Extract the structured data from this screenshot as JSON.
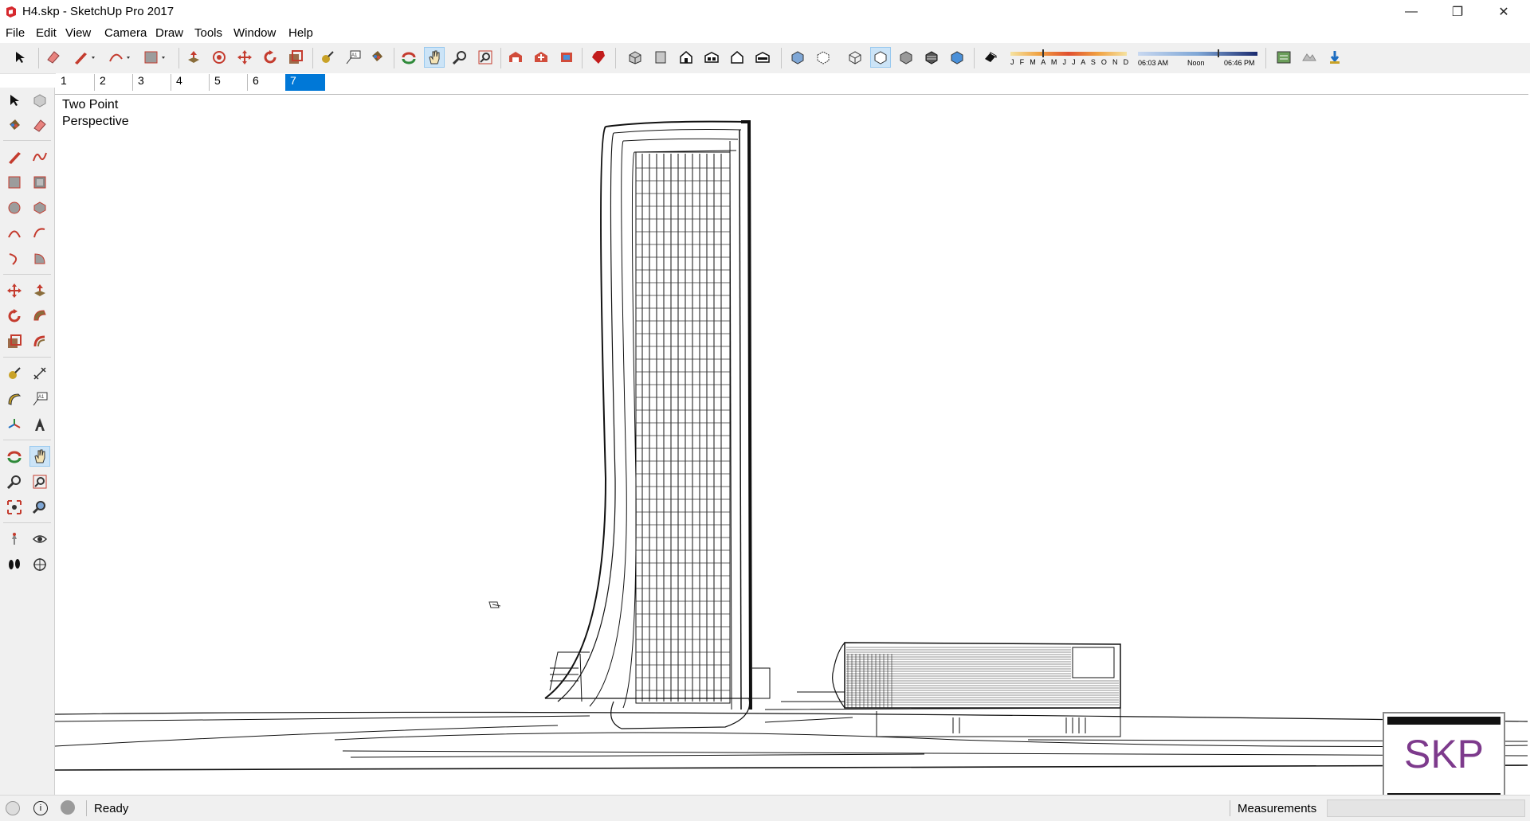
{
  "window": {
    "title": "H4.skp - SketchUp Pro 2017",
    "minimize_icon": "minimize-icon",
    "maximize_icon": "restore-icon",
    "close_icon": "close-icon"
  },
  "menubar": {
    "items": [
      "File",
      "Edit",
      "View",
      "Camera",
      "Draw",
      "Tools",
      "Window",
      "Help"
    ]
  },
  "shadow_settings": {
    "months": "J F M A M J J A S O N D",
    "time_start": "06:03 AM",
    "time_mid": "Noon",
    "time_end": "06:46 PM"
  },
  "scenes": {
    "tabs": [
      "1",
      "2",
      "3",
      "4",
      "5",
      "6",
      "7"
    ],
    "active_index": 6
  },
  "viewport": {
    "camera_label_line1": "Two Point",
    "camera_label_line2": "Perspective"
  },
  "statusbar": {
    "status": "Ready",
    "measurements_label": "Measurements",
    "measurements_value": ""
  },
  "badge": {
    "text": "SKP"
  },
  "colors": {
    "active_tab": "#0078d7",
    "badge_text": "#7d3a8c",
    "toolbar_bg": "#f0f0f0"
  }
}
